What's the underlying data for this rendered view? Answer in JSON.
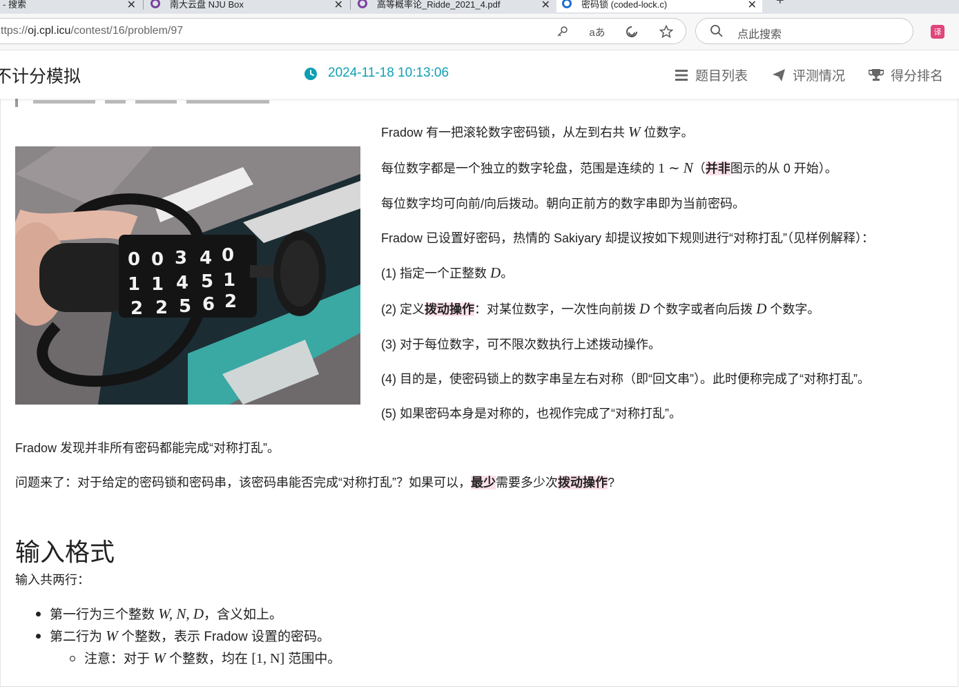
{
  "browser": {
    "tabs": [
      {
        "title": "- 搜索",
        "state": "inactive"
      },
      {
        "title": "南大云盘 NJU Box",
        "state": "inactive"
      },
      {
        "title": "高等概率论_Ridde_2021_4.pdf",
        "state": "inactive"
      },
      {
        "title": "密码锁 (coded-lock.c)",
        "state": "active"
      }
    ],
    "url_prefix": "ttps://",
    "url_domain": "oj.cpl.icu",
    "url_path": "/contest/16/problem/97",
    "search_placeholder": "点此搜索",
    "translate_label": "译"
  },
  "header": {
    "contest_title": "不计分模拟",
    "time": "2024-11-18 10:13:06",
    "nav": [
      "题目列表",
      "评测情况",
      "得分排名"
    ],
    "accent_color": "#0f9fb3"
  },
  "problem": {
    "lock_digits": [
      [
        "0",
        "0",
        "3",
        "4",
        "0"
      ],
      [
        "1",
        "1",
        "4",
        "5",
        "1"
      ],
      [
        "2",
        "2",
        "5",
        "6",
        "2"
      ]
    ],
    "desc": {
      "p1": {
        "a": "Fradow 有一把滚轮数字密码锁，从左到右共 ",
        "m1": "W",
        "b": " 位数字。"
      },
      "p2": {
        "a": "每位数字都是一个独立的数字轮盘，范围是连续的 ",
        "m1": "1",
        "tilde": " ∼ ",
        "m2": "N",
        "b": "（",
        "hl": "并非",
        "c": "图示的从 0 开始）。"
      },
      "p3": "每位数字均可向前/向后拨动。朝向正前方的数字串即为当前密码。",
      "p4": "Fradow 已设置好密码，热情的 Sakiyary 却提议按如下规则进行“对称打乱”（见样例解释）：",
      "r1": {
        "a": "(1) 指定一个正整数 ",
        "m1": "D",
        "b": "。"
      },
      "r2": {
        "a": "(2) 定义",
        "hl": "拨动操作",
        "b": "：对某位数字，一次性向前拨 ",
        "m1": "D",
        "c": " 个数字或者向后拨 ",
        "m2": "D",
        "d": " 个数字。"
      },
      "r3": "(3) 对于每位数字，可不限次数执行上述拨动操作。",
      "r4": "(4) 目的是，使密码锁上的数字串呈左右对称（即“回文串”）。此时便称完成了“对称打乱”。",
      "r5": "(5) 如果密码本身是对称的，也视作完成了“对称打乱”。",
      "f1": "Fradow 发现并非所有密码都能完成“对称打乱”。",
      "q": {
        "a": "问题来了：对于给定的密码锁和密码串，该密码串能否完成“对称打乱”？如果可以，",
        "hl1": "最少",
        "b": "需要多少次",
        "hl2": "拨动操作",
        "c": "?"
      }
    },
    "input_section": {
      "title": "输入格式",
      "intro": "输入共两行：",
      "li1": {
        "a": "第一行为三个整数 ",
        "m": "W, N, D",
        "b": "，含义如上。"
      },
      "li2": {
        "a": "第二行为 ",
        "m": "W",
        "b": " 个整数，表示 Fradow 设置的密码。"
      },
      "li3": {
        "a": "注意：对于 ",
        "m1": "W",
        "b": " 个整数，均在 ",
        "m2": "[1, N]",
        "c": " 范围中。"
      }
    }
  }
}
